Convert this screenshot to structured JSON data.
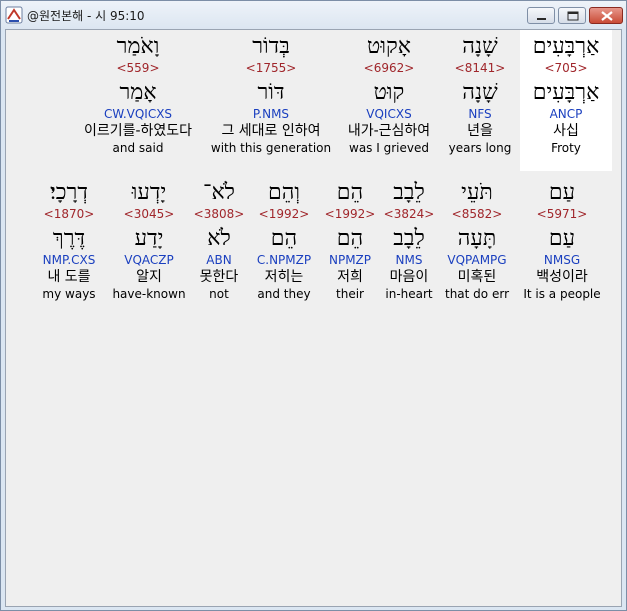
{
  "window": {
    "title": "@원전본해 - 시 95:10",
    "buttons": {
      "minimize": "minimize",
      "maximize": "maximize",
      "close": "close"
    }
  },
  "rows": [
    {
      "words": [
        {
          "hebrew": "אַרְבָּעִים",
          "strong": "<705>",
          "lemma": "אַרְבָּעִים",
          "code": "ANCP",
          "korean": "사십",
          "english": "Froty",
          "highlight": true
        },
        {
          "hebrew": "שָׁנָה",
          "strong": "<8141>",
          "lemma": "שָׁנָה",
          "code": "NFS",
          "korean": "년을",
          "english": "years long"
        },
        {
          "hebrew": "אָקוּט",
          "strong": "<6962>",
          "lemma": "קוּט",
          "code": "VQICXS",
          "korean": "내가-근심하여",
          "english": "was I grieved"
        },
        {
          "hebrew": "בְּדוֹר",
          "strong": "<1755>",
          "lemma": "דּוֹר",
          "code": "P.NMS",
          "korean": "그 세대로 인하여",
          "english": "with this generation"
        },
        {
          "hebrew": "וָאֹמַר",
          "strong": "<559>",
          "lemma": "אָמַר",
          "code": "CW.VQICXS",
          "korean": "이르기를-하였도다",
          "english": "and said"
        }
      ]
    },
    {
      "words": [
        {
          "hebrew": "עַם",
          "strong": "<5971>",
          "lemma": "עַם",
          "code": "NMSG",
          "korean": "백성이라",
          "english": "It is a people"
        },
        {
          "hebrew": "תֹּעֵי",
          "strong": "<8582>",
          "lemma": "תָּעָה",
          "code": "VQPAMPG",
          "korean": "미혹된",
          "english": "that do err"
        },
        {
          "hebrew": "לֵבָב",
          "strong": "<3824>",
          "lemma": "לֵבָב",
          "code": "NMS",
          "korean": "마음이",
          "english": "in-heart"
        },
        {
          "hebrew": "הֵם",
          "strong": "<1992>",
          "lemma": "הֵם",
          "code": "NPMZP",
          "korean": "저희",
          "english": "their"
        },
        {
          "hebrew": "וְהֵם",
          "strong": "<1992>",
          "lemma": "הֵם",
          "code": "C.NPMZP",
          "korean": "저히는",
          "english": "and they"
        },
        {
          "hebrew": "לֹא־",
          "strong": "<3808>",
          "lemma": "לֹא",
          "code": "ABN",
          "korean": "못한다",
          "english": "not"
        },
        {
          "hebrew": "יָדְעוּ",
          "strong": "<3045>",
          "lemma": "יָדַע",
          "code": "VQACZP",
          "korean": "알지",
          "english": "have-known"
        },
        {
          "hebrew": "דְרָכָי׃",
          "strong": "<1870>",
          "lemma": "דֶּרֶךְ",
          "code": "NMP.CXS",
          "korean": "내 도를",
          "english": "my ways"
        }
      ]
    }
  ]
}
